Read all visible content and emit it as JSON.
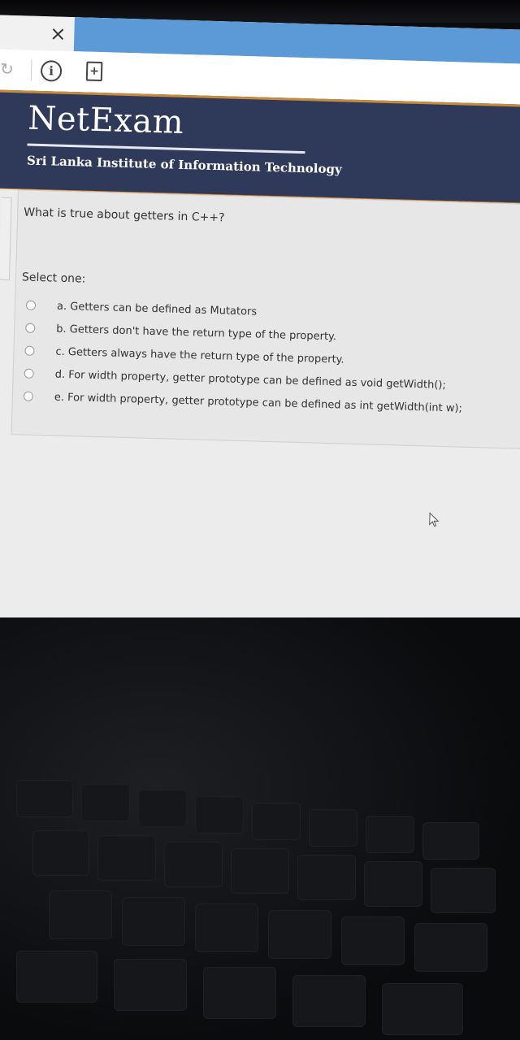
{
  "browser": {
    "close_glyph": "×",
    "reload_glyph": "↻",
    "info_glyph": "i",
    "page_glyph": "+"
  },
  "header": {
    "title": "NetExam",
    "subtitle": "Sri Lanka Institute of Information Technology",
    "banner_color": "#2f3a5a",
    "accent_color": "#e08a2c"
  },
  "question": {
    "text": "What is true about getters in C++?",
    "prompt": "Select one:",
    "options": [
      {
        "label": "a. Getters can be defined as Mutators"
      },
      {
        "label": "b. Getters don't have the return type of the property."
      },
      {
        "label": "c. Getters always have the return type of the property."
      },
      {
        "label": "d. For width property, getter prototype can be defined as void getWidth();"
      },
      {
        "label": "e. For width property, getter prototype can be defined as int getWidth(int w);"
      }
    ]
  }
}
